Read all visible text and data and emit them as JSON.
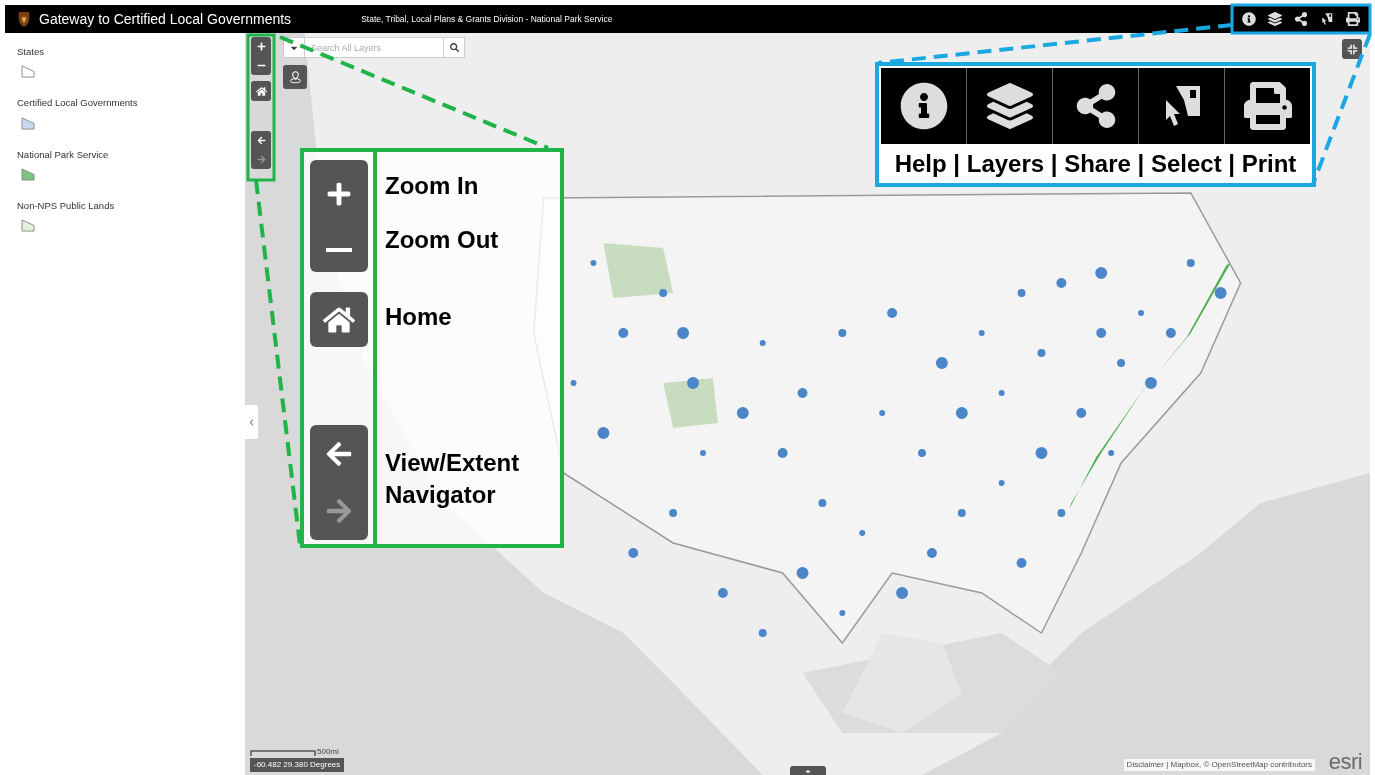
{
  "header": {
    "title": "Gateway to Certified Local Governments",
    "subtitle": "State, Tribal, Local Plans & Grants Division - National Park Service"
  },
  "legend": [
    {
      "label": "States",
      "color": "#ffffff"
    },
    {
      "label": "Certified Local Governments",
      "color": "#c6d9f1"
    },
    {
      "label": "National Park Service",
      "color": "#7cc47f"
    },
    {
      "label": "Non-NPS Public Lands",
      "color": "#e3efd6"
    }
  ],
  "search": {
    "placeholder": "Search All Layers"
  },
  "navigator": {
    "back_disabled": false,
    "forward_disabled": true
  },
  "scale": {
    "label": "500mi"
  },
  "coordinates": "-60.482 29.380 Degrees",
  "attribution": "Disclaimer | Mapbox, © OpenStreetMap contributors",
  "logo": "esri",
  "callouts": {
    "navigation": {
      "labels": [
        "Zoom In",
        "Zoom Out",
        "Home",
        "View/Extent Navigator"
      ]
    },
    "toolbar": {
      "caption": "Help | Layers | Share | Select | Print"
    }
  }
}
